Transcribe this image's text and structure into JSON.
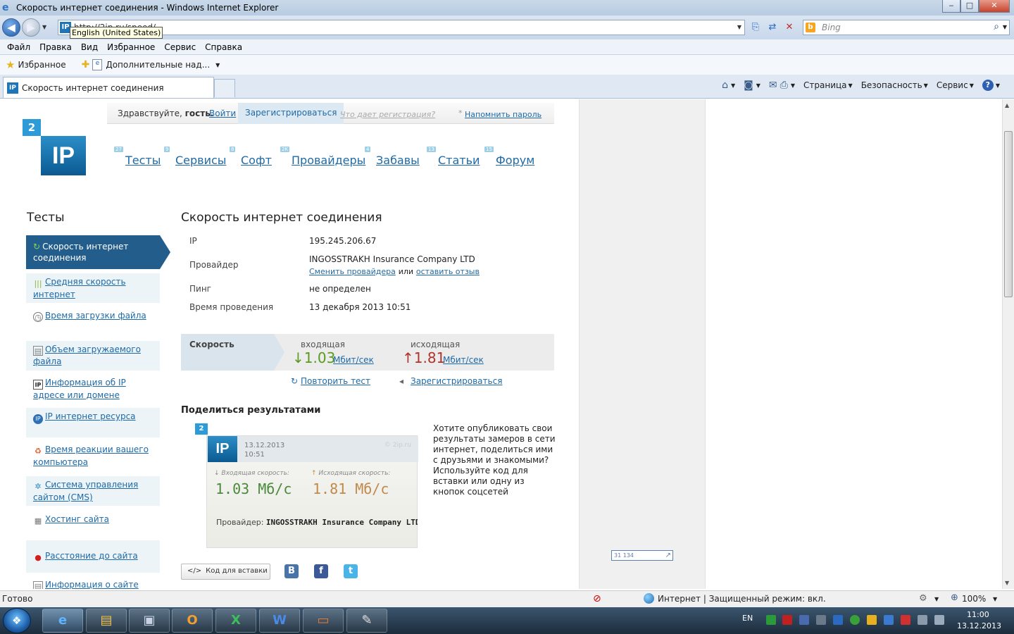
{
  "window": {
    "title": "Скорость интернет соединения - Windows Internet Explorer",
    "min_label": "‒",
    "max_label": "□",
    "close_label": "✕"
  },
  "address": {
    "url": "http://2ip.ru/speed/",
    "lang_tooltip": "English (United States)",
    "search_placeholder": "Bing"
  },
  "menu": [
    "Файл",
    "Правка",
    "Вид",
    "Избранное",
    "Сервис",
    "Справка"
  ],
  "favorites": {
    "label": "Избранное",
    "addons": "Дополнительные над..."
  },
  "tab": {
    "title": "Скорость интернет соединения"
  },
  "command_bar": {
    "page": "Страница",
    "safety": "Безопасность",
    "tools": "Сервис"
  },
  "site": {
    "logo_small": "2",
    "logo_big": "IP",
    "greeting_prefix": "Здравствуйте,",
    "greeting_user": "гость.",
    "login": "Войти",
    "register": "Зарегистрироваться",
    "why_register": "Что дает регистрация?",
    "remind_password": "Напомнить пароль",
    "nav": [
      {
        "label": "Тесты",
        "count": "27"
      },
      {
        "label": "Сервисы",
        "count": "9"
      },
      {
        "label": "Софт",
        "count": "8"
      },
      {
        "label": "Провайдеры",
        "count": "2K"
      },
      {
        "label": "Забавы",
        "count": "4"
      },
      {
        "label": "Статьи",
        "count": "13"
      },
      {
        "label": "Форум",
        "count": "15"
      }
    ]
  },
  "sidebar": {
    "title": "Тесты",
    "active": "Скорость интернет соединения",
    "items": [
      "Средняя скорость интернет",
      "Время загрузки файла",
      "Объем загружаемого файла",
      "Информация об IP адресе или домене",
      "IP интернет ресурса",
      "Время реакции вашего компьютера",
      "Система управления сайтом (CMS)",
      "Хостинг сайта",
      "Расстояние до сайта",
      "Информация о сайте"
    ]
  },
  "main": {
    "title": "Скорость интернет соединения",
    "ip_label": "IP",
    "ip_value": "195.245.206.67",
    "provider_label": "Провайдер",
    "provider_value": "INGOSSTRAKH Insurance Company LTD",
    "change_provider": "Сменить провайдера",
    "or": "или",
    "leave_review": "оставить отзыв",
    "ping_label": "Пинг",
    "ping_value": "не определен",
    "time_label": "Время проведения",
    "time_value": "13 декабря 2013 10:51",
    "speed_label": "Скорость",
    "incoming_caption": "входящая",
    "incoming_value": "1.03",
    "outgoing_caption": "исходящая",
    "outgoing_value": "1.81",
    "unit": "Мбит/сек",
    "repeat_test": "Повторить тест",
    "register": "Зарегистрироваться",
    "share_title": "Поделиться результатами",
    "share_text": "Хотите опубликовать свои результаты замеров в сети интернет, поделиться ими с друзьями и знакомыми? Используйте код для вставки или одну из кнопок соцсетей",
    "embed_button": "Код для вставки"
  },
  "card": {
    "small_logo": "2",
    "logo": "IP",
    "date": "13.12.2013",
    "time": "10:51",
    "copyright": "© 2ip.ru",
    "in_caption": "Входящая скорость:",
    "in_value": "1.03 Мб/с",
    "out_caption": "Исходящая скорость:",
    "out_value": "1.81 Мб/с",
    "provider_label": "Провайдер:",
    "provider_value": "INGOSSTRAKH Insurance Company LTD"
  },
  "counter": "31 134",
  "status": {
    "text": "Готово",
    "zone": "Интернет | Защищенный режим: вкл.",
    "zoom": "100%"
  },
  "taskbar": {
    "lang": "EN",
    "time": "11:00",
    "date": "13.12.2013"
  },
  "colors": {
    "incoming": "#5a9a1e",
    "outgoing": "#b0342a",
    "card_in": "#4a8a3a",
    "card_out": "#c08a4a",
    "link": "#1e6aa8"
  }
}
